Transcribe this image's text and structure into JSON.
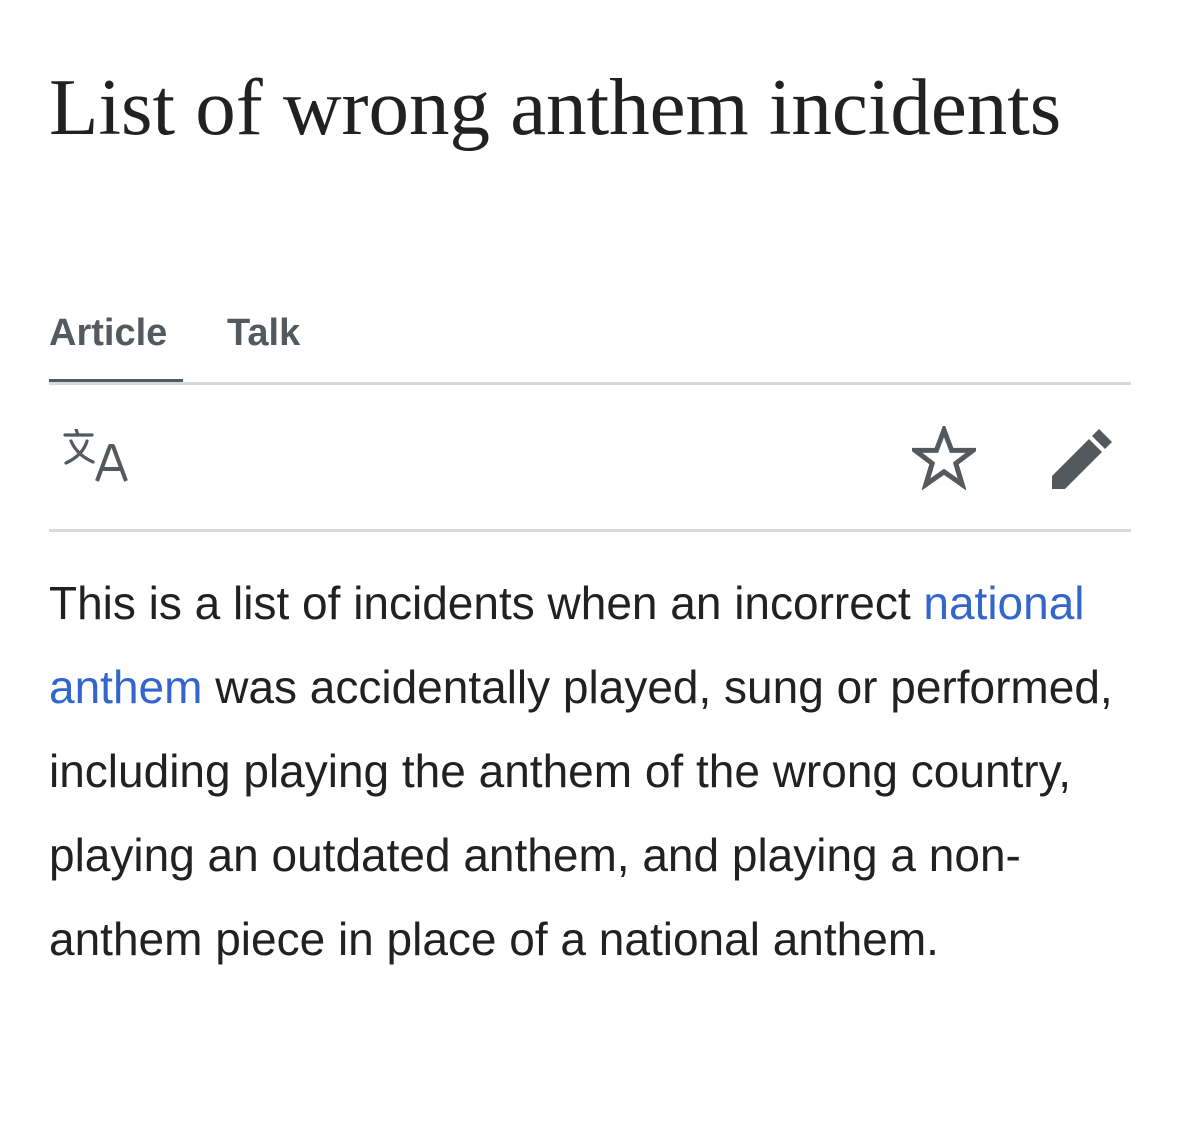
{
  "article": {
    "title": "List of wrong anthem incidents"
  },
  "tabs": [
    {
      "label": "Article",
      "active": true
    },
    {
      "label": "Talk",
      "active": false
    }
  ],
  "toolbar": {
    "language_icon": "translate-icon",
    "watch_icon": "star-icon",
    "edit_icon": "pencil-icon"
  },
  "lead": {
    "text_before_link": "This is a list of incidents when an incorrect ",
    "link_text": "national anthem",
    "text_after_link": " was accidentally played, sung or performed, including playing the anthem of the wrong country, playing an outdated anthem, and playing a non-anthem piece in place of a national anthem."
  },
  "colors": {
    "text": "#202122",
    "tab_text": "#54595d",
    "link": "#3366cc",
    "divider": "#d7d9dc",
    "icon": "#54595d"
  }
}
